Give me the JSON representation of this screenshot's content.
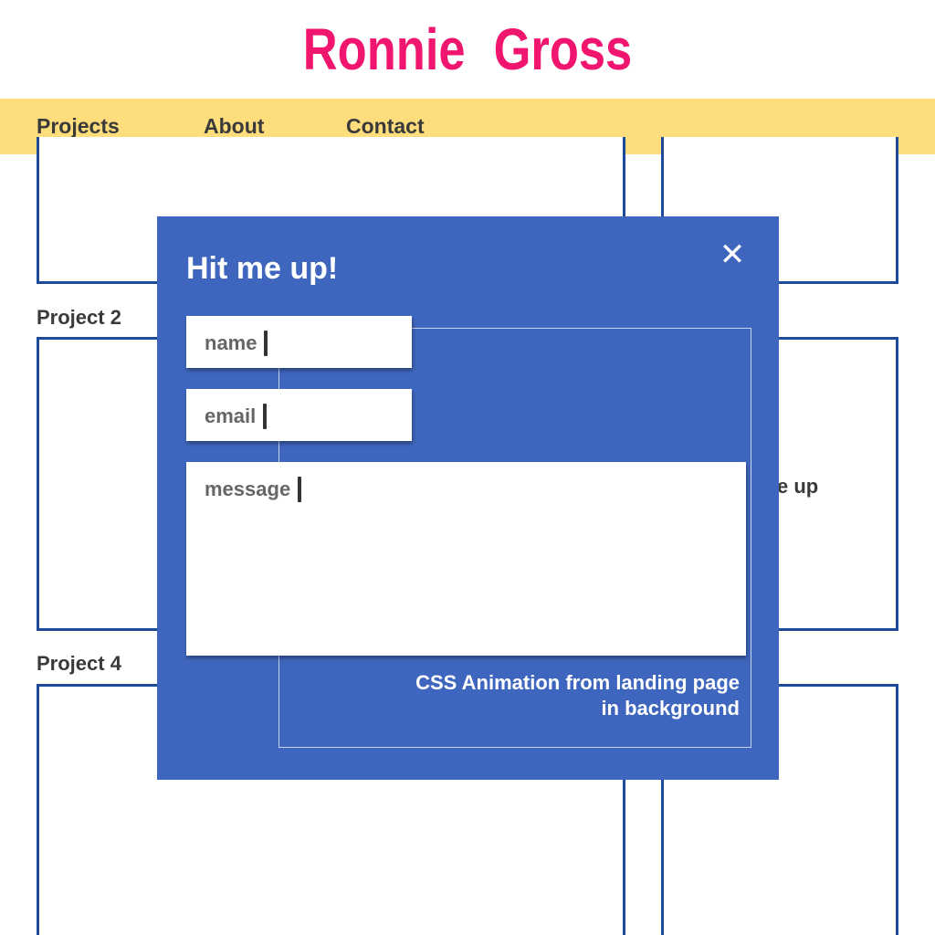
{
  "header": {
    "title": "Ronnie   Gross"
  },
  "nav": {
    "items": [
      {
        "label": "Projects"
      },
      {
        "label": "About"
      },
      {
        "label": "Contact"
      }
    ]
  },
  "background": {
    "projects": [
      {
        "label": "Project 2"
      },
      {
        "label": "Project 4"
      }
    ],
    "snippet": "e up"
  },
  "modal": {
    "title": "Hit me up!",
    "close_symbol": "✕",
    "close_icon": "close-icon",
    "fields": {
      "name_placeholder": "name",
      "email_placeholder": "email",
      "message_placeholder": "message"
    },
    "caption_line1": "CSS Animation from landing page",
    "caption_line2": "in background"
  },
  "colors": {
    "brand_pink": "#f0156e",
    "nav_yellow": "#fedd7c",
    "modal_blue": "#3f66be",
    "border_blue": "#1e4a9c"
  }
}
